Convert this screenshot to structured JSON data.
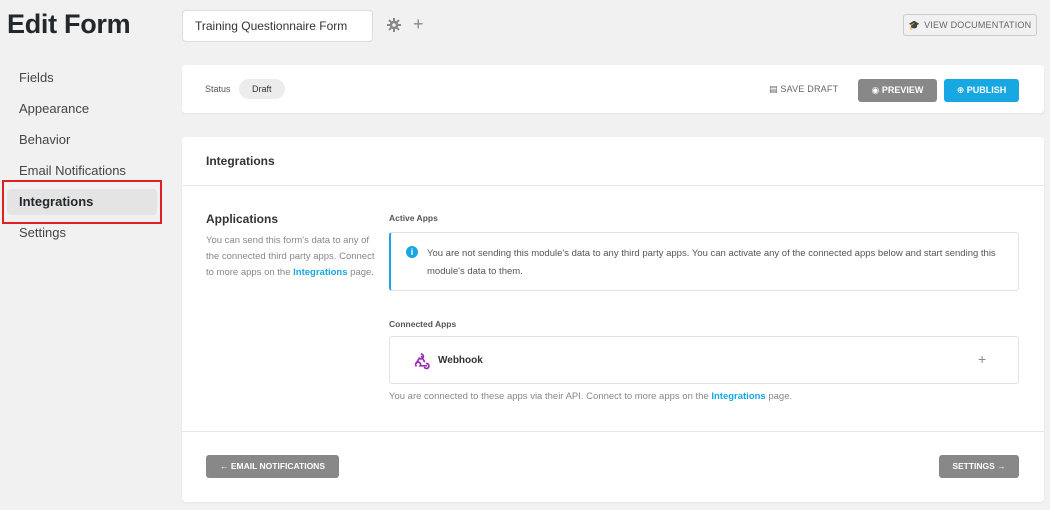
{
  "page": {
    "title": "Edit Form"
  },
  "sidebar": {
    "items": [
      {
        "label": "Fields",
        "active": false
      },
      {
        "label": "Appearance",
        "active": false
      },
      {
        "label": "Behavior",
        "active": false
      },
      {
        "label": "Email Notifications",
        "active": false
      },
      {
        "label": "Integrations",
        "active": true
      },
      {
        "label": "Settings",
        "active": false
      }
    ]
  },
  "topbar": {
    "form_name": "Training Questionnaire Form",
    "add_symbol": "+",
    "doc_label": "VIEW DOCUMENTATION",
    "doc_icon": "graduation-cap-icon"
  },
  "status_bar": {
    "status_label": "Status",
    "status_value": "Draft",
    "save_draft_label": "SAVE DRAFT",
    "preview_label": "PREVIEW",
    "publish_label": "PUBLISH",
    "publish_color": "#17a8e3"
  },
  "integrations": {
    "header": "Integrations",
    "applications_title": "Applications",
    "applications_desc_pre": "You can send this form's data to any of the connected third party apps. Connect to more apps on the ",
    "applications_desc_link": "Integrations",
    "applications_desc_post": " page.",
    "active_apps_label": "Active Apps",
    "notice_text": "You are not sending this module's data to any third party apps. You can activate any of the connected apps below and start sending this module's data to them.",
    "connected_apps_label": "Connected Apps",
    "apps": [
      {
        "name": "Webhook",
        "icon": "webhook-icon"
      }
    ],
    "add_symbol": "+",
    "api_text_pre": "You are connected to these apps via their API. Connect to more apps on the ",
    "api_text_link": "Integrations",
    "api_text_post": " page."
  },
  "footer": {
    "back_label": "← EMAIL NOTIFICATIONS",
    "next_label": "SETTINGS →"
  }
}
